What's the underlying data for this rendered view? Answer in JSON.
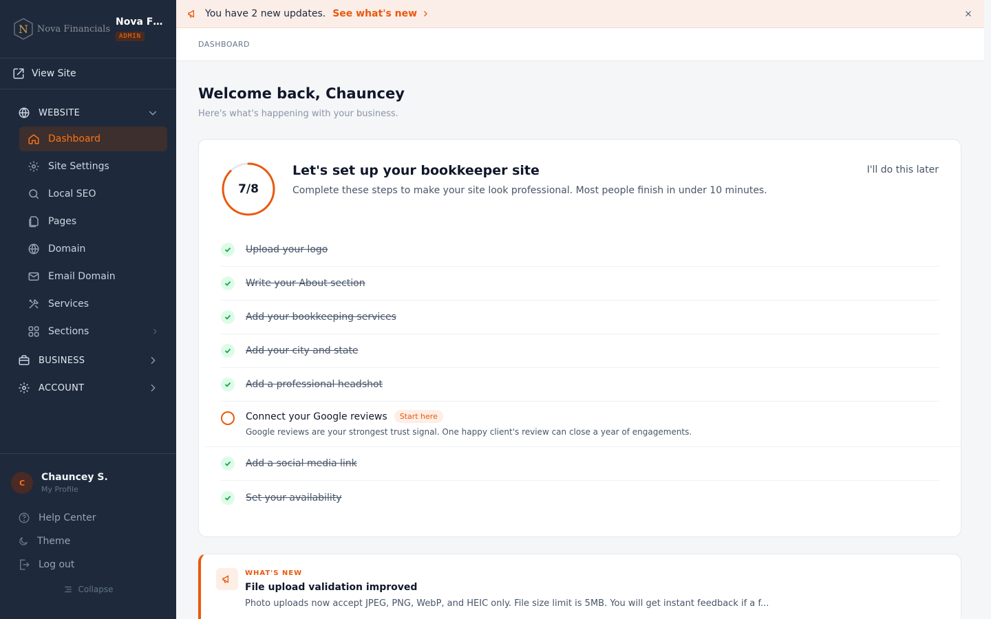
{
  "brand": {
    "logo_text": "Nova Financials",
    "name": "Nova Fin...",
    "role": "ADMIN"
  },
  "view_site": "View Site",
  "nav": {
    "website": "WEBSITE",
    "items": [
      {
        "label": "Dashboard",
        "icon": "home-icon"
      },
      {
        "label": "Site Settings",
        "icon": "gear-icon"
      },
      {
        "label": "Local SEO",
        "icon": "search-icon"
      },
      {
        "label": "Pages",
        "icon": "pages-icon"
      },
      {
        "label": "Domain",
        "icon": "globe-icon"
      },
      {
        "label": "Email Domain",
        "icon": "mail-icon"
      },
      {
        "label": "Services",
        "icon": "tools-icon"
      },
      {
        "label": "Sections",
        "icon": "grid-icon"
      }
    ],
    "business": "BUSINESS",
    "account": "ACCOUNT"
  },
  "profile": {
    "initial": "C",
    "name": "Chauncey S.",
    "sub": "My Profile"
  },
  "footer": {
    "help": "Help Center",
    "theme": "Theme",
    "logout": "Log out",
    "collapse": "Collapse"
  },
  "banner": {
    "message": "You have 2 new updates.",
    "link": "See what's new"
  },
  "breadcrumb": "DASHBOARD",
  "welcome": {
    "title": "Welcome back, Chauncey",
    "subtitle": "Here's what's happening with your business."
  },
  "setup": {
    "progress_text": "7/8",
    "progress_fraction": 0.875,
    "title": "Let's set up your bookkeeper site",
    "subtitle": "Complete these steps to make your site look professional. Most people finish in under 10 minutes.",
    "later": "I'll do this later",
    "steps": [
      {
        "label": "Upload your logo"
      },
      {
        "label": "Write your About section"
      },
      {
        "label": "Add your bookkeeping services"
      },
      {
        "label": "Add your city and state"
      },
      {
        "label": "Add a professional headshot"
      }
    ],
    "open_step": {
      "label": "Connect your Google reviews",
      "tag": "Start here",
      "desc": "Google reviews are your strongest trust signal. One happy client's review can close a year of engagements."
    },
    "steps_after": [
      {
        "label": "Add a social media link"
      },
      {
        "label": "Set your availability"
      }
    ]
  },
  "news": {
    "kicker": "WHAT'S NEW",
    "title": "File upload validation improved",
    "desc": "Photo uploads now accept JPEG, PNG, WebP, and HEIC only. File size limit is 5MB. You will get instant feedback if a f..."
  },
  "colors": {
    "accent": "#ea580c",
    "sidebar": "#1e293b",
    "success_bg": "#dcfce7",
    "success": "#16a34a"
  }
}
